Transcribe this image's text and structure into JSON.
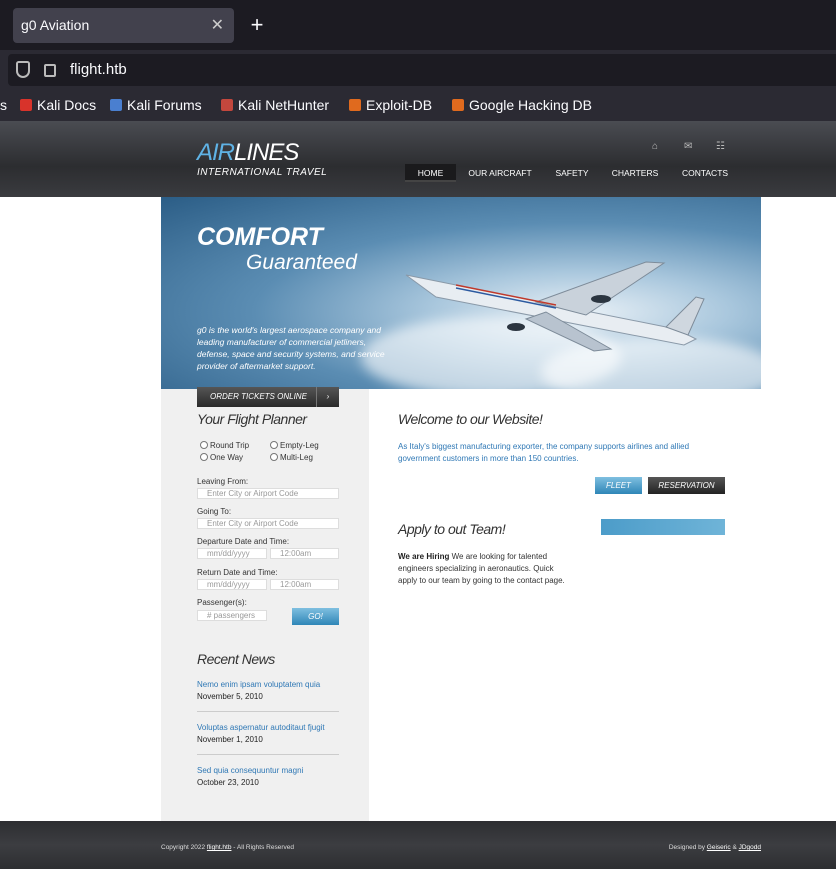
{
  "browser": {
    "tab_title": "g0 Aviation",
    "url": "flight.htb",
    "bookmarks": [
      {
        "label": "s",
        "icon": "none"
      },
      {
        "label": "Kali Docs",
        "icon": "kali-docs-icon"
      },
      {
        "label": "Kali Forums",
        "icon": "kali-forums-icon"
      },
      {
        "label": "Kali NetHunter",
        "icon": "kali-nethunter-icon"
      },
      {
        "label": "Exploit-DB",
        "icon": "exploit-db-icon"
      },
      {
        "label": "Google Hacking DB",
        "icon": "ghdb-icon"
      }
    ]
  },
  "site": {
    "logo_top_accent": "AIR",
    "logo_top_rest": "LINES",
    "logo_sub": "INTERNATIONAL TRAVEL",
    "nav": [
      "HOME",
      "OUR AIRCRAFT",
      "SAFETY",
      "CHARTERS",
      "CONTACTS"
    ],
    "hero": {
      "title1": "COMFORT",
      "title2": "Guaranteed",
      "text": "g0 is the world's largest aerospace company and leading manufacturer of commercial jetliners, defense, space and security systems, and service provider of aftermarket support."
    },
    "planner": {
      "order_button": "ORDER TICKETS ONLINE",
      "heading": "Your Flight Planner",
      "radios": [
        "Round Trip",
        "Empty-Leg",
        "One Way",
        "Multi-Leg"
      ],
      "leaving_label": "Leaving From:",
      "leaving_placeholder": "Enter City or Airport Code",
      "going_label": "Going To:",
      "going_placeholder": "Enter City or Airport Code",
      "departure_label": "Departure Date and Time:",
      "date_placeholder": "mm/dd/yyyy",
      "time_placeholder": "12:00am",
      "return_label": "Return Date and Time:",
      "passengers_label": "Passenger(s):",
      "passengers_placeholder": "# passengers",
      "go_button": "GO!"
    },
    "news": {
      "heading": "Recent News",
      "items": [
        {
          "title": "Nemo enim ipsam voluptatem quia",
          "date": "November 5, 2010"
        },
        {
          "title": "Voluptas aspernatur autoditaut fjugit",
          "date": "November 1, 2010"
        },
        {
          "title": "Sed quia consequuntur magni",
          "date": "October 23, 2010"
        }
      ]
    },
    "welcome": {
      "heading": "Welcome to our Website!",
      "text": "As Italy's biggest manufacturing exporter, the company supports airlines and allied government customers in more than 150 countries.",
      "fleet_button": "FLEET",
      "reservation_button": "RESERVATION"
    },
    "apply": {
      "heading": "Apply to out Team!",
      "bold": "We are Hiring",
      "text": " We are looking for talented engineers specializing in aeronautics. Quick apply to our team by going to the contact page."
    },
    "footer": {
      "copyright_prefix": "Copyright 2022 ",
      "copyright_link": "flight.htb",
      "copyright_suffix": " - All Rights Reserved",
      "designed_prefix": "Designed by ",
      "designer1": "Geiseric",
      "amp": " & ",
      "designer2": "JDgodd"
    }
  }
}
